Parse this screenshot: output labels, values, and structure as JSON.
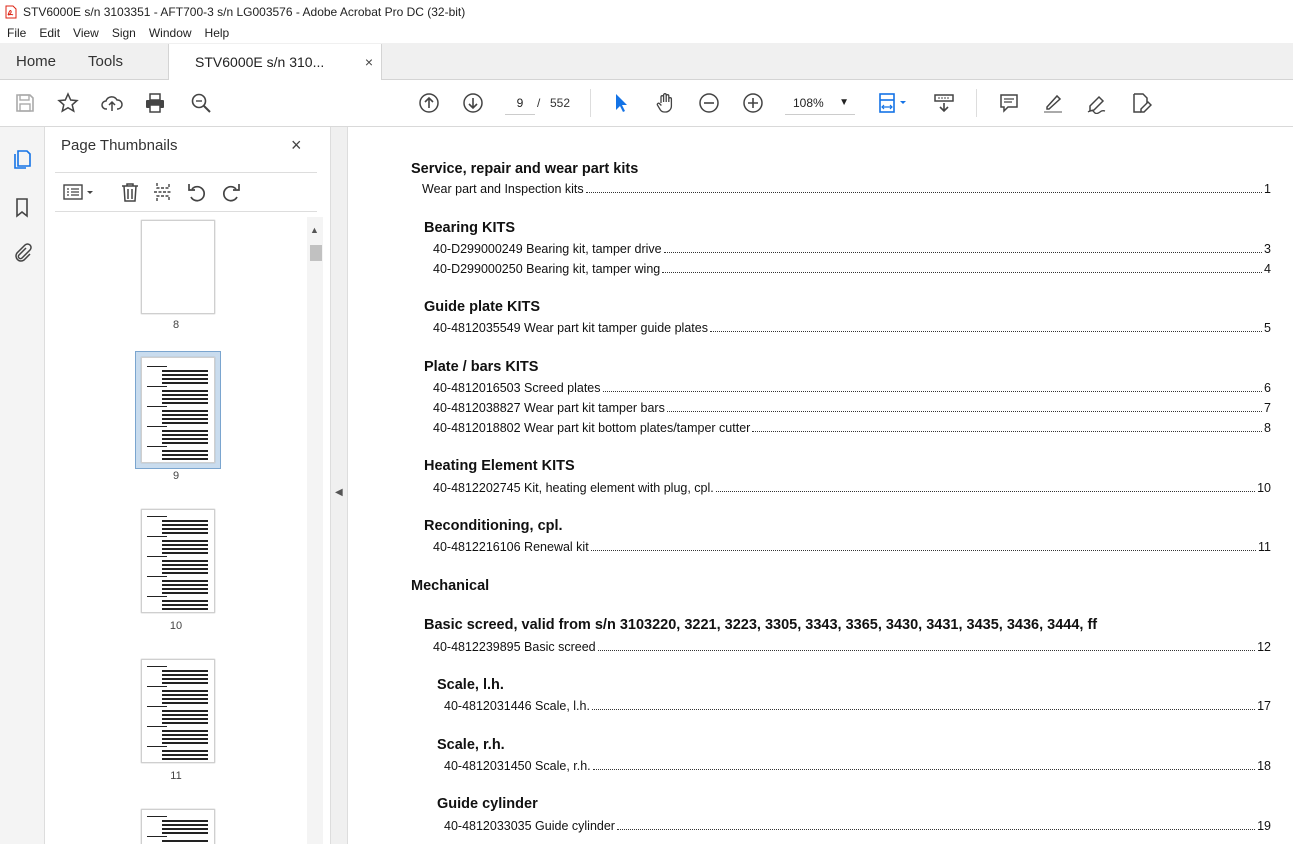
{
  "window": {
    "title": "STV6000E s/n 3103351 - AFT700-3 s/n LG003576 - Adobe Acrobat Pro DC (32-bit)"
  },
  "menu": [
    "File",
    "Edit",
    "View",
    "Sign",
    "Window",
    "Help"
  ],
  "tabs": {
    "home": "Home",
    "tools": "Tools",
    "document": "STV6000E s/n 310...",
    "close": "×"
  },
  "toolbar": {
    "current_page": "9",
    "page_sep": "/",
    "total_pages": "552",
    "zoom": "108%"
  },
  "panel": {
    "title": "Page Thumbnails",
    "close": "×",
    "thumbnails": [
      {
        "label": "8"
      },
      {
        "label": "9",
        "selected": true
      },
      {
        "label": "10"
      },
      {
        "label": "11"
      }
    ]
  },
  "toc": {
    "rows": [
      {
        "kind": "h",
        "text": "Service, repair and wear part kits"
      },
      {
        "kind": "e",
        "text": "Wear part and Inspection kits",
        "page": "1"
      },
      {
        "kind": "h",
        "text": "Bearing KITS"
      },
      {
        "kind": "e",
        "text": "40-D299000249 Bearing kit, tamper drive",
        "page": "3"
      },
      {
        "kind": "e",
        "text": "40-D299000250 Bearing kit, tamper wing",
        "page": "4"
      },
      {
        "kind": "h",
        "text": "Guide plate KITS"
      },
      {
        "kind": "e",
        "text": "40-4812035549 Wear part kit tamper guide plates",
        "page": "5"
      },
      {
        "kind": "h",
        "text": "Plate / bars KITS"
      },
      {
        "kind": "e",
        "text": "40-4812016503 Screed plates",
        "page": "6"
      },
      {
        "kind": "e",
        "text": "40-4812038827 Wear part kit tamper bars",
        "page": "7"
      },
      {
        "kind": "e",
        "text": "40-4812018802 Wear part kit bottom plates/tamper cutter",
        "page": "8"
      },
      {
        "kind": "h",
        "text": "Heating Element KITS"
      },
      {
        "kind": "e",
        "text": "40-4812202745 Kit, heating element with plug, cpl.",
        "page": "10"
      },
      {
        "kind": "h",
        "text": "Reconditioning, cpl."
      },
      {
        "kind": "e",
        "text": "40-4812216106 Renewal kit",
        "page": "11"
      },
      {
        "kind": "h",
        "text": "Mechanical"
      },
      {
        "kind": "h",
        "text": "Basic screed, valid from s/n 3103220, 3221, 3223, 3305, 3343, 3365, 3430, 3431, 3435, 3436, 3444, ff"
      },
      {
        "kind": "e",
        "text": "40-4812239895 Basic screed",
        "page": "12"
      },
      {
        "kind": "h",
        "text": "Scale, l.h."
      },
      {
        "kind": "e",
        "text": "40-4812031446 Scale, l.h.",
        "page": "17"
      },
      {
        "kind": "h",
        "text": "Scale, r.h."
      },
      {
        "kind": "e",
        "text": "40-4812031450 Scale, r.h.",
        "page": "18"
      },
      {
        "kind": "h",
        "text": "Guide cylinder"
      },
      {
        "kind": "e",
        "text": "40-4812033035 Guide cylinder",
        "page": "19"
      }
    ]
  }
}
